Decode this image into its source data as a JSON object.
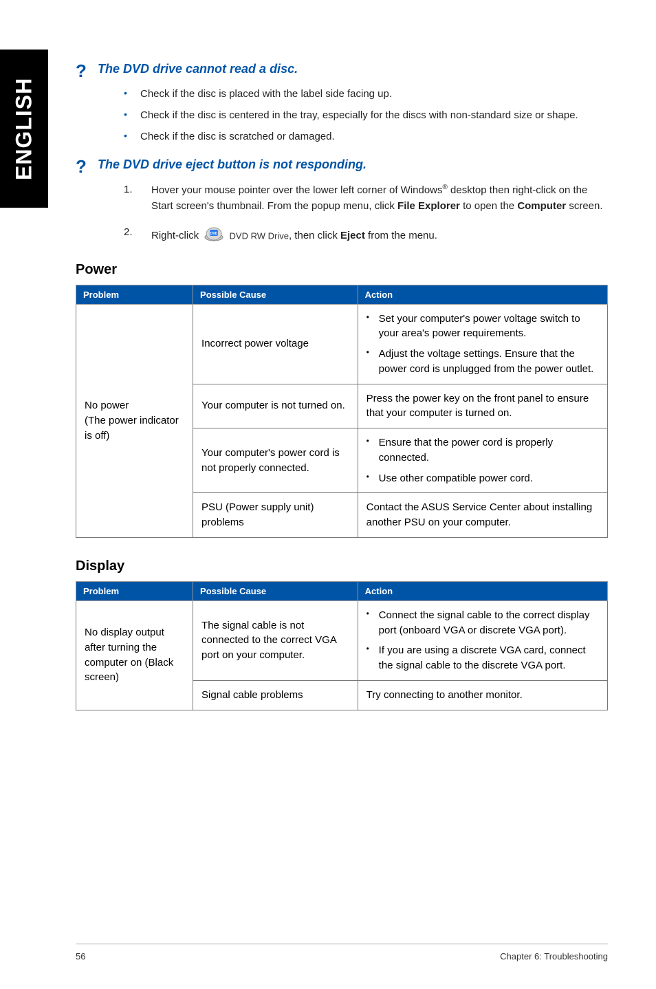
{
  "sidebar": {
    "label": "ENGLISH"
  },
  "q1": {
    "title": "The DVD drive cannot read a disc.",
    "bullets": [
      "Check if the disc is placed with the label side facing up.",
      "Check if the disc is centered in the tray, especially for the discs with non-standard size or shape.",
      "Check if the disc is scratched or damaged."
    ]
  },
  "q2": {
    "title": "The DVD drive eject button is not responding.",
    "step1_a": "Hover your mouse pointer over the lower left corner of Windows",
    "step1_b": " desktop then right-click on the Start screen's thumbnail. From the popup menu, click ",
    "step1_file": "File Explorer",
    "step1_c": " to open the ",
    "step1_comp": "Computer",
    "step1_d": " screen.",
    "step2_a": "Right-click ",
    "dvd_label": "DVD RW Drive",
    "step2_b": ", then click ",
    "step2_eject": "Eject",
    "step2_c": " from the menu."
  },
  "power": {
    "heading": "Power",
    "th_problem": "Problem",
    "th_cause": "Possible Cause",
    "th_action": "Action",
    "problem": "No power\n(The power indicator is off)",
    "rows": [
      {
        "cause": "Incorrect power voltage",
        "action_list": [
          "Set your computer's power voltage switch to your area's power requirements.",
          "Adjust the voltage settings. Ensure that the power cord is unplugged from the power outlet."
        ]
      },
      {
        "cause": "Your computer is not turned on.",
        "action_text": "Press the power key on the front panel to ensure that your computer is turned on."
      },
      {
        "cause": "Your computer's power cord is not properly connected.",
        "action_list": [
          "Ensure that the power cord is properly connected.",
          "Use other compatible power cord."
        ]
      },
      {
        "cause": "PSU (Power supply unit) problems",
        "action_text": "Contact the ASUS Service Center about installing another PSU on your computer."
      }
    ]
  },
  "display": {
    "heading": "Display",
    "th_problem": "Problem",
    "th_cause": "Possible Cause",
    "th_action": "Action",
    "problem": "No display output after turning the computer on (Black screen)",
    "rows": [
      {
        "cause": "The signal cable is not connected to the correct VGA port on your computer.",
        "action_list": [
          "Connect the signal cable to the correct display port (onboard VGA or discrete VGA port).",
          "If you are using a discrete VGA card, connect the signal cable to the discrete VGA port."
        ]
      },
      {
        "cause": "Signal cable problems",
        "action_text": "Try connecting to another monitor."
      }
    ]
  },
  "footer": {
    "pagenum": "56",
    "chapter": "Chapter 6: Troubleshooting"
  }
}
